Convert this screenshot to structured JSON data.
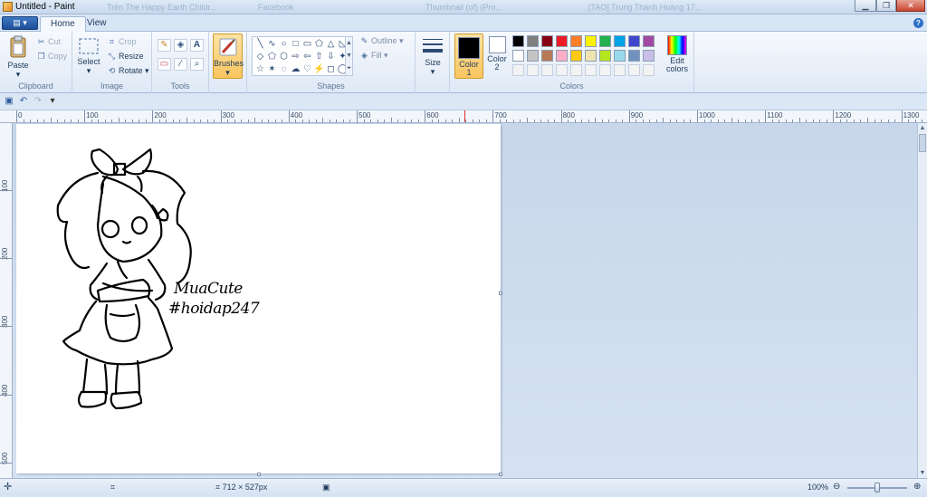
{
  "window": {
    "title": "Untitled - Paint",
    "background_tabs": [
      "Trên The Happy Earth Childr...",
      "Facebook",
      "Thumbnail (of) (Pro...",
      "[TAO] Trung Thành Hoàng 17..."
    ],
    "controls": [
      "minimize",
      "maximize",
      "close"
    ]
  },
  "tabs": {
    "app_menu": "▤ ▾",
    "items": [
      {
        "label": "Home",
        "active": true
      },
      {
        "label": "View",
        "active": false
      }
    ],
    "help": "?"
  },
  "ribbon": {
    "clipboard": {
      "paste": "Paste",
      "cut": "Cut",
      "copy": "Copy",
      "label": "Clipboard"
    },
    "image": {
      "select": "Select",
      "crop": "Crop",
      "resize": "Resize",
      "rotate": "Rotate",
      "label": "Image"
    },
    "tools": {
      "label": "Tools",
      "icons": [
        "pencil-icon",
        "fill-icon",
        "text-icon",
        "eraser-icon",
        "color-picker-icon",
        "magnifier-icon"
      ],
      "glyphs": [
        "✎",
        "◈",
        "A",
        "▭",
        "⁄",
        "⌕"
      ]
    },
    "brushes": {
      "label": "Brushes"
    },
    "shapes": {
      "label": "Shapes",
      "outline": "Outline",
      "fill": "Fill",
      "glyphs": [
        "╲",
        "∿",
        "○",
        "□",
        "▭",
        "⬠",
        "△",
        "◺",
        "◇",
        "⬠",
        "⬡",
        "⇨",
        "⇦",
        "⇧",
        "⇩",
        "✦",
        "☆",
        "✶",
        "◌",
        "☁",
        "♡",
        "⚡",
        "◻",
        "◯",
        "◜",
        "◝",
        "◞",
        "◟"
      ]
    },
    "size": {
      "label": "Size"
    },
    "colors": {
      "color1_label": "Color\n1",
      "color1": "#000000",
      "color2_label": "Color\n2",
      "color2": "#ffffff",
      "label": "Colors",
      "edit": "Edit\ncolors",
      "row1": [
        "#000000",
        "#7f7f7f",
        "#880015",
        "#ed1c24",
        "#ff7f27",
        "#fff200",
        "#22b14c",
        "#00a2e8",
        "#3f48cc",
        "#a349a4"
      ],
      "row2": [
        "#ffffff",
        "#c3c3c3",
        "#b97a57",
        "#ffaec9",
        "#ffc90e",
        "#efe4b0",
        "#b5e61d",
        "#99d9ea",
        "#7092be",
        "#c8bfe7"
      ],
      "row3": [
        "#f3f3f3",
        "#f3f3f3",
        "#f3f3f3",
        "#f3f3f3",
        "#f3f3f3",
        "#f3f3f3",
        "#f3f3f3",
        "#f3f3f3",
        "#f3f3f3",
        "#f3f3f3"
      ]
    }
  },
  "qat": {
    "icons": [
      "save-icon",
      "undo-icon",
      "redo-icon",
      "customize-icon"
    ]
  },
  "ruler": {
    "h_labels": [
      "0",
      "100",
      "200",
      "300",
      "400",
      "500",
      "600",
      "700",
      "800",
      "900",
      "1000",
      "1100",
      "1200",
      "1300"
    ],
    "v_labels": [
      "100",
      "200",
      "300",
      "400",
      "500"
    ]
  },
  "canvas": {
    "handwriting_line1": "MuaCute",
    "handwriting_line2": "#hoidap247"
  },
  "status": {
    "canvas_size": "712 × 527px",
    "zoom": "100%"
  }
}
